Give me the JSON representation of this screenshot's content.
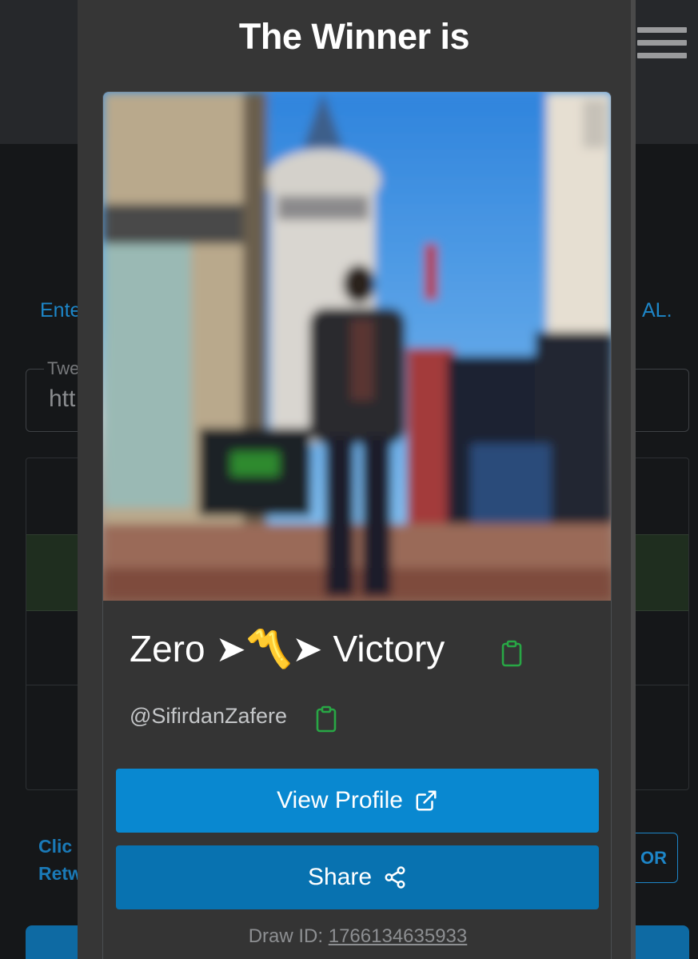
{
  "background": {
    "enter_text": "Ente",
    "al_text": "AL.",
    "input_label": "Twe",
    "input_value": "htt",
    "click_text_line1": "Clic",
    "click_text_line2": "Retw",
    "or_button_label": "OR"
  },
  "modal": {
    "title": "The Winner is",
    "winner_name": "Zero ➤〽️➤ Victory",
    "winner_handle": "@SifirdanZafere",
    "view_profile_label": "View Profile",
    "share_label": "Share",
    "draw_id_label": "Draw ID:",
    "draw_id_value": "1766134635933"
  },
  "colors": {
    "accent_blue": "#0988d0",
    "share_blue": "#0872b0",
    "copy_icon_green": "#28a745",
    "modal_bg": "#363636"
  },
  "icons": {
    "menu": "hamburger-icon",
    "copy": "clipboard-icon",
    "external": "external-link-icon",
    "share": "share-icon"
  }
}
